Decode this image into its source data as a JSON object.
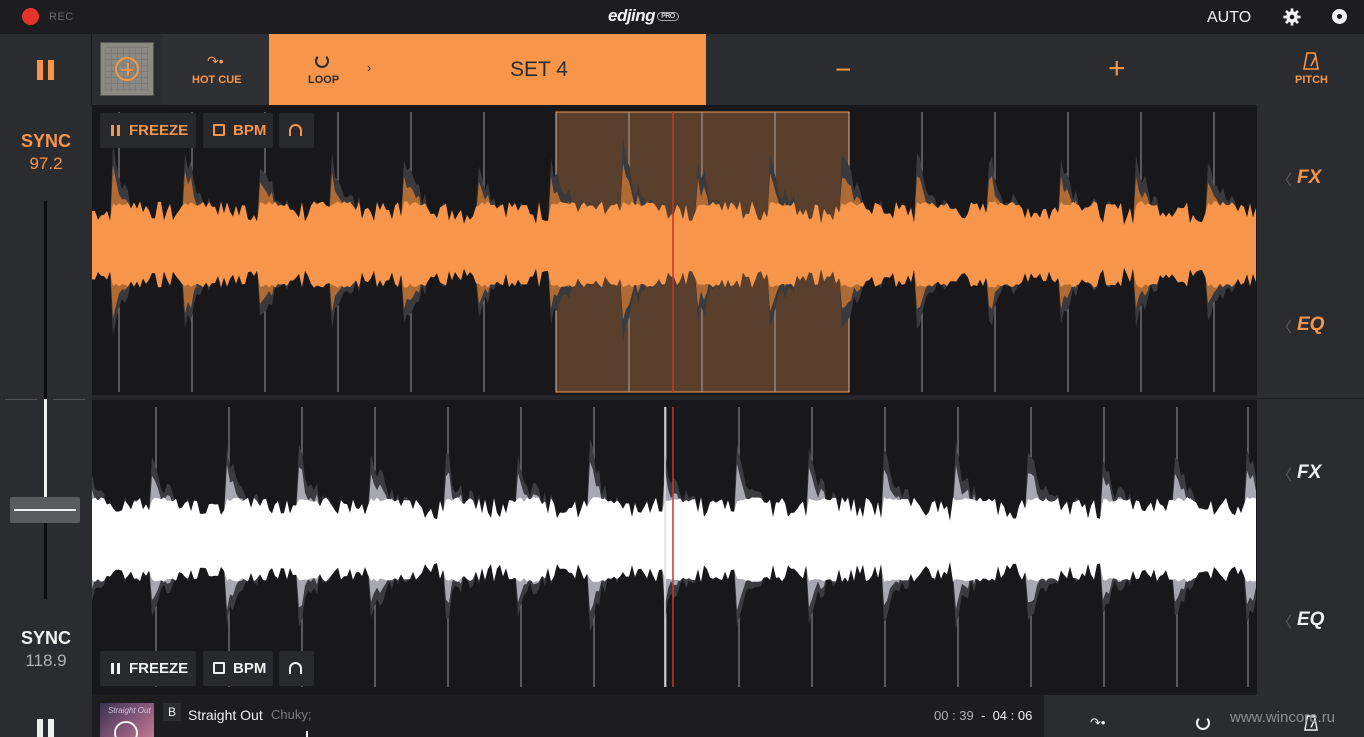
{
  "topbar": {
    "rec_label": "REC",
    "logo_text": "edjing",
    "logo_badge": "PRO",
    "auto_label": "AUTO",
    "icons": [
      "record-icon",
      "gear-icon",
      "disc-icon"
    ]
  },
  "toolbar": {
    "hotcue_label": "HOT CUE",
    "loop_label": "LOOP",
    "loop_arrow": "›",
    "set_label": "SET 4",
    "minus_label": "−",
    "plus_label": "+",
    "pitch_label": "PITCH"
  },
  "deck_a": {
    "sync_label": "SYNC",
    "bpm": "97.2",
    "freeze_label": "FREEZE",
    "bpm_label": "BPM",
    "fx_label": "FX",
    "eq_label": "EQ",
    "loop_active": true
  },
  "deck_b": {
    "sync_label": "SYNC",
    "bpm": "118.9",
    "freeze_label": "FREEZE",
    "bpm_label": "BPM",
    "fx_label": "FX",
    "eq_label": "EQ"
  },
  "bottombar": {
    "cover_text": "Straight Out",
    "deck_letter": "B",
    "track_title": "Straight Out",
    "track_artist": "Chuky;",
    "elapsed": "00 : 39",
    "separator": "-",
    "total": "04 : 06",
    "watermark": "www.wincore.ru"
  },
  "colors": {
    "accent": "#f7964a",
    "panel": "#2b2c30",
    "deck_bg": "#18181b",
    "waveform_b": "#ffffff",
    "playhead": "#c0392b"
  }
}
